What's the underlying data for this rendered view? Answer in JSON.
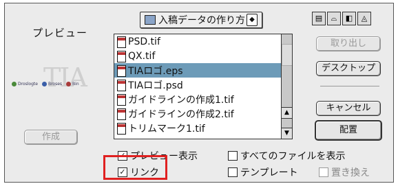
{
  "preview_label": "プレビュー",
  "preview_image": {
    "title": "TIA",
    "logos": [
      "Droslogte",
      "Broses",
      "Bin"
    ]
  },
  "create_button": "作成",
  "location_popup": {
    "label": "入稿データの作り方",
    "arrow": "◆"
  },
  "files": [
    {
      "name": "PSD.tif",
      "selected": false
    },
    {
      "name": "QX.tif",
      "selected": false
    },
    {
      "name": "TIAロゴ.eps",
      "selected": true
    },
    {
      "name": "TIAロゴ.psd",
      "selected": false
    },
    {
      "name": "ガイドラインの作成1.tif",
      "selected": false
    },
    {
      "name": "ガイドラインの作成2.tif",
      "selected": false
    },
    {
      "name": "トリムマーク1.tif",
      "selected": false
    }
  ],
  "buttons": {
    "eject": "取り出し",
    "desktop": "デスクトップ",
    "cancel": "キャンセル",
    "place": "配置"
  },
  "checkboxes": {
    "show_preview": {
      "label": "プレビュー表示",
      "checked": true
    },
    "show_all_files": {
      "label": "すべてのファイルを表示",
      "checked": false
    },
    "link": {
      "label": "リンク",
      "checked": true
    },
    "template": {
      "label": "テンプレート",
      "checked": false
    },
    "replace": {
      "label": "置き換え",
      "checked": false
    }
  },
  "colors": {
    "selection": "#6d9bb8",
    "highlight": "#e02020"
  }
}
